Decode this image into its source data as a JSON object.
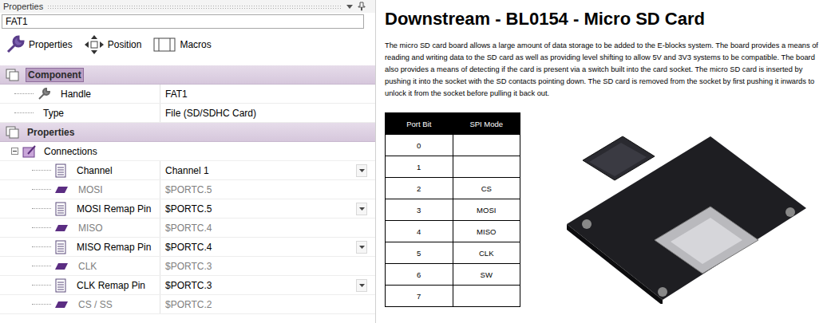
{
  "panel": {
    "title": "Properties",
    "object": "FAT1",
    "toolbar": [
      {
        "label": "Properties",
        "kind": "wrench"
      },
      {
        "label": "Position",
        "kind": "move"
      },
      {
        "label": "Macros",
        "kind": "macro"
      }
    ],
    "sections": [
      {
        "title": "Component",
        "selected": true,
        "rows": [
          {
            "kind": "wrench",
            "label": "Handle",
            "value": "FAT1",
            "disabled": false,
            "dropdown": false
          },
          {
            "kind": "plain",
            "label": "Type",
            "value": "File (SD/SDHC Card)",
            "disabled": false,
            "dropdown": false
          }
        ]
      },
      {
        "title": "Properties",
        "selected": false,
        "rows": [
          {
            "kind": "group",
            "label": "Connections",
            "expanded": true,
            "rows": [
              {
                "kind": "list",
                "label": "Channel",
                "value": "Channel 1",
                "disabled": false,
                "dropdown": true
              },
              {
                "kind": "pin",
                "label": "MOSI",
                "value": "$PORTC.5",
                "disabled": true,
                "dropdown": false
              },
              {
                "kind": "list",
                "label": "MOSI Remap Pin",
                "value": "$PORTC.5",
                "disabled": false,
                "dropdown": true
              },
              {
                "kind": "pin",
                "label": "MISO",
                "value": "$PORTC.4",
                "disabled": true,
                "dropdown": false
              },
              {
                "kind": "list",
                "label": "MISO Remap Pin",
                "value": "$PORTC.4",
                "disabled": false,
                "dropdown": true
              },
              {
                "kind": "pin",
                "label": "CLK",
                "value": "$PORTC.3",
                "disabled": true,
                "dropdown": false
              },
              {
                "kind": "list",
                "label": "CLK Remap Pin",
                "value": "$PORTC.3",
                "disabled": false,
                "dropdown": true
              },
              {
                "kind": "pin",
                "label": "CS / SS",
                "value": "$PORTC.2",
                "disabled": true,
                "dropdown": false
              }
            ]
          }
        ]
      }
    ]
  },
  "document": {
    "title": "Downstream - BL0154 - Micro SD Card",
    "paragraph": "The micro SD card board allows a large amount of data storage to be added to the E-blocks system. The board provides a means of reading and writing data to the SD card as well as providing level shifting to allow 5V and 3V3 systems to be compatible.  The board also provides a means of detecting if the card is present via a switch built into the card socket. The micro SD card is inserted by pushing it into the socket with the SD contacts pointing down. The SD card is removed from the socket by first pushing it inwards to unlock it from the socket before pulling it back out.",
    "table": {
      "columns": [
        "Port Bit",
        "SPI Mode"
      ],
      "rows": [
        [
          "0",
          ""
        ],
        [
          "1",
          ""
        ],
        [
          "2",
          "CS"
        ],
        [
          "3",
          "MOSI"
        ],
        [
          "4",
          "MISO"
        ],
        [
          "5",
          "CLK"
        ],
        [
          "6",
          "SW"
        ],
        [
          "7",
          ""
        ]
      ]
    }
  }
}
